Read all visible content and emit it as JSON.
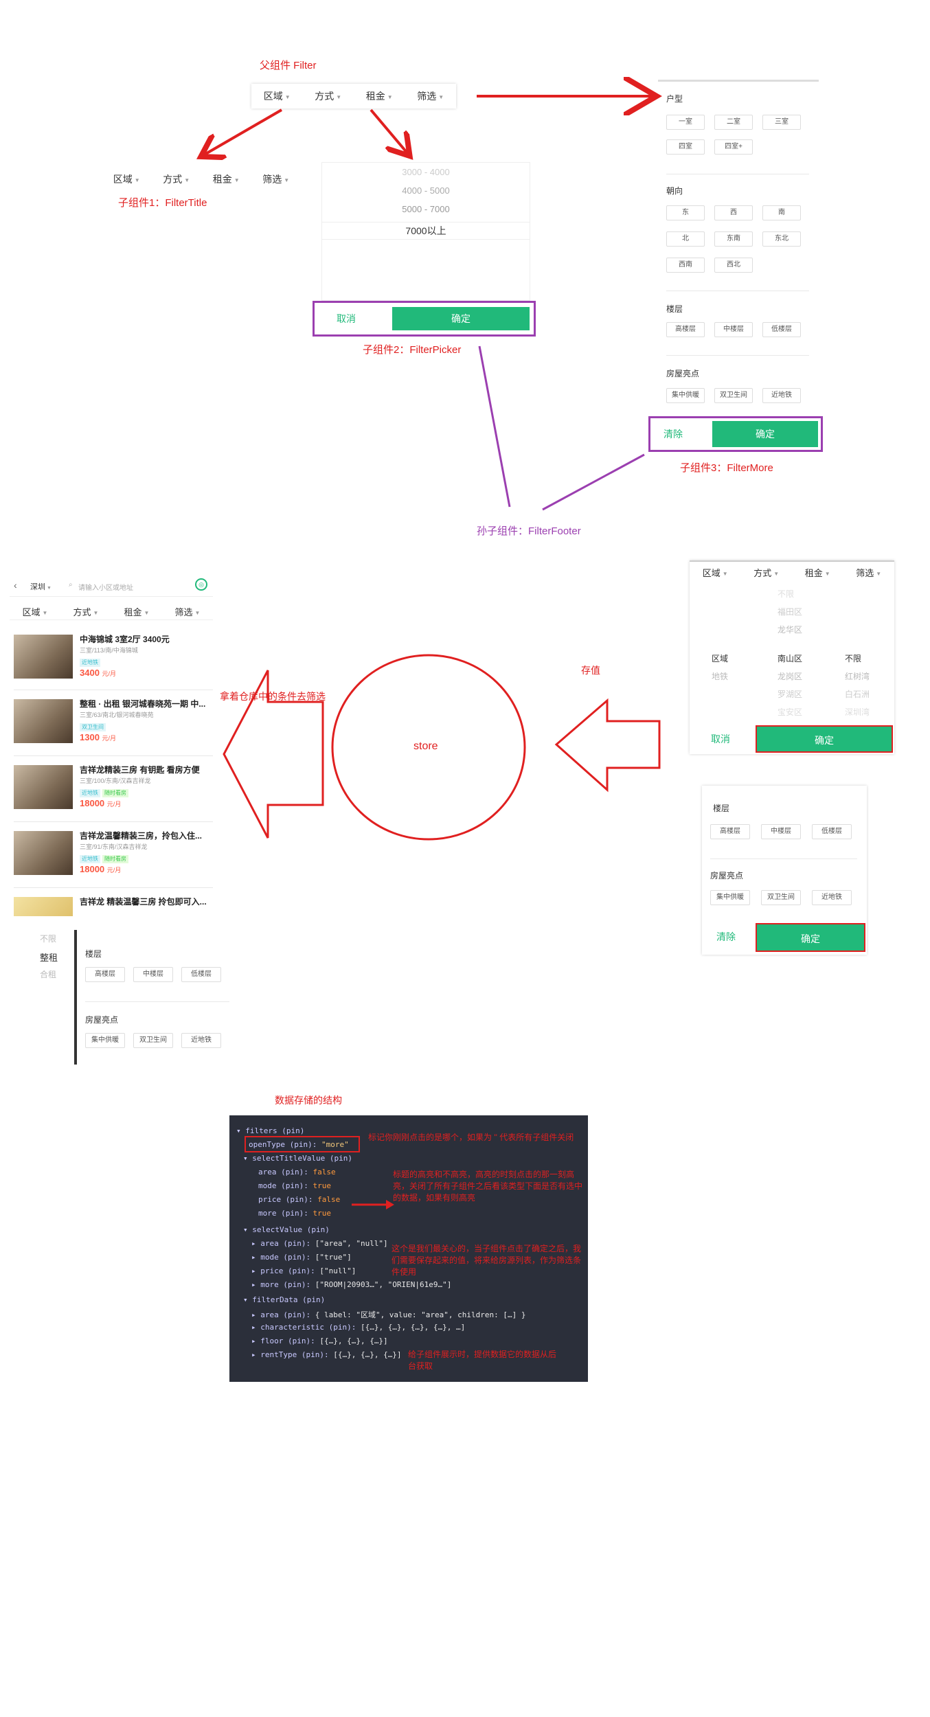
{
  "labels": {
    "parent": "父组件 Filter",
    "child1": "子组件1：FilterTitle",
    "child2": "子组件2：FilterPicker",
    "child3": "子组件3：FilterMore",
    "grandchild": "孙子组件：FilterFooter",
    "store": "store",
    "save": "存值",
    "fetch": "拿着仓库中的条件去筛选",
    "data_struct": "数据存储的结构"
  },
  "filter_titles": [
    "区域",
    "方式",
    "租金",
    "筛选"
  ],
  "picker_top": {
    "options": [
      "3000 - 4000",
      "4000 - 5000",
      "5000 - 7000",
      "7000以上"
    ],
    "cancel": "取消",
    "confirm": "确定"
  },
  "more_top": {
    "sections": [
      {
        "title": "户型",
        "tags": [
          "一室",
          "二室",
          "三室",
          "四室",
          "四室+"
        ]
      },
      {
        "title": "朝向",
        "tags": [
          "东",
          "西",
          "南",
          "北",
          "东南",
          "东北",
          "西南",
          "西北"
        ]
      },
      {
        "title": "楼层",
        "tags": [
          "高楼层",
          "中楼层",
          "低楼层"
        ]
      },
      {
        "title": "房屋亮点",
        "tags": [
          "集中供暖",
          "双卫生间",
          "近地铁"
        ]
      }
    ],
    "clear": "清除",
    "confirm": "确定"
  },
  "list_page": {
    "city": "深圳",
    "search_placeholder": "请输入小区或地址",
    "houses": [
      {
        "title": "中海锦城 3室2厅 3400元",
        "desc": "三室/113/南/中海锦城",
        "tags": [
          "近地铁"
        ],
        "price": "3400",
        "unit": "元/月"
      },
      {
        "title": "整租 · 出租 银河城春晓苑一期 中...",
        "desc": "三室/63/南北/银河城春晓苑",
        "tags": [
          "双卫生间"
        ],
        "price": "1300",
        "unit": "元/月"
      },
      {
        "title": "吉祥龙精装三房 有钥匙 看房方便",
        "desc": "三室/100/东南/汉森吉祥龙",
        "tags": [
          "近地铁",
          "随时看房"
        ],
        "price": "18000",
        "unit": "元/月"
      },
      {
        "title": "吉祥龙温馨精装三房，拎包入住...",
        "desc": "三室/91/东南/汉森吉祥龙",
        "tags": [
          "近地铁",
          "随时看房"
        ],
        "price": "18000",
        "unit": "元/月"
      },
      {
        "title": "吉祥龙 精装温馨三房 拎包即可入..."
      }
    ],
    "mode_options": [
      "不限",
      "整租",
      "合租"
    ],
    "floor_title": "楼层",
    "floor_tags": [
      "高楼层",
      "中楼层",
      "低楼层"
    ],
    "highlight_title": "房屋亮点",
    "highlight_tags": [
      "集中供暖",
      "双卫生间",
      "近地铁"
    ]
  },
  "right_picker": {
    "col1": [
      "区域",
      "地铁"
    ],
    "col2": [
      "不限",
      "福田区",
      "龙华区",
      "南山区",
      "龙岗区",
      "罗湖区",
      "宝安区"
    ],
    "col3": [
      "不限",
      "红树湾",
      "白石洲",
      "深圳湾"
    ],
    "cancel": "取消",
    "confirm": "确定"
  },
  "right_more": {
    "floor_title": "楼层",
    "floor_tags": [
      "高楼层",
      "中楼层",
      "低楼层"
    ],
    "highlight_title": "房屋亮点",
    "highlight_tags": [
      "集中供暖",
      "双卫生间",
      "近地铁"
    ],
    "clear": "清除",
    "confirm": "确定"
  },
  "code": {
    "lines": [
      {
        "k": "▾ filters (pin)",
        "v": ""
      },
      {
        "k": "openType (pin): ",
        "v": "\"more\""
      },
      {
        "k": "▾ selectTitleValue (pin)",
        "v": ""
      },
      {
        "k": "area (pin): ",
        "v": "false"
      },
      {
        "k": "mode (pin): ",
        "v": "true"
      },
      {
        "k": "price (pin): ",
        "v": "false"
      },
      {
        "k": "more (pin): ",
        "v": "true"
      },
      {
        "k": "▾ selectValue (pin)",
        "v": ""
      },
      {
        "k": "▸ area (pin): ",
        "v": "[\"area\", \"null\"]"
      },
      {
        "k": "▸ mode (pin): ",
        "v": "[\"true\"]"
      },
      {
        "k": "▸ price (pin): ",
        "v": "[\"null\"]"
      },
      {
        "k": "▸ more (pin): ",
        "v": "[\"ROOM|20903…\", \"ORIEN|61e9…\"]"
      },
      {
        "k": "▾ filterData (pin)",
        "v": ""
      },
      {
        "k": "▸ area (pin): ",
        "v": "{ label: \"区域\", value: \"area\", children: […] }"
      },
      {
        "k": "▸ characteristic (pin): ",
        "v": "[{…}, {…}, {…}, {…}, …]"
      },
      {
        "k": "▸ floor (pin): ",
        "v": "[{…}, {…}, {…}]"
      },
      {
        "k": "▸ rentType (pin): ",
        "v": "[{…}, {…}, {…}]"
      }
    ],
    "notes": {
      "n1": "标记你刚刚点击的是哪个，如果为 '' 代表所有子组件关闭",
      "n2": "标题的高亮和不高亮，高亮的时刻点击的那一刻高亮，关闭了所有子组件之后看该类型下面是否有选中的数据，如果有则高亮",
      "n3": "这个是我们最关心的，当子组件点击了确定之后，我们需要保存起来的值，将来给房源列表，作为筛选条件使用",
      "n4": "给子组件展示时，提供数据它的数据从后台获取"
    }
  },
  "colors": {
    "red": "#e02020",
    "purple": "#9b3fb0",
    "green": "#21b97a",
    "code_bg": "#2b2f3a"
  }
}
